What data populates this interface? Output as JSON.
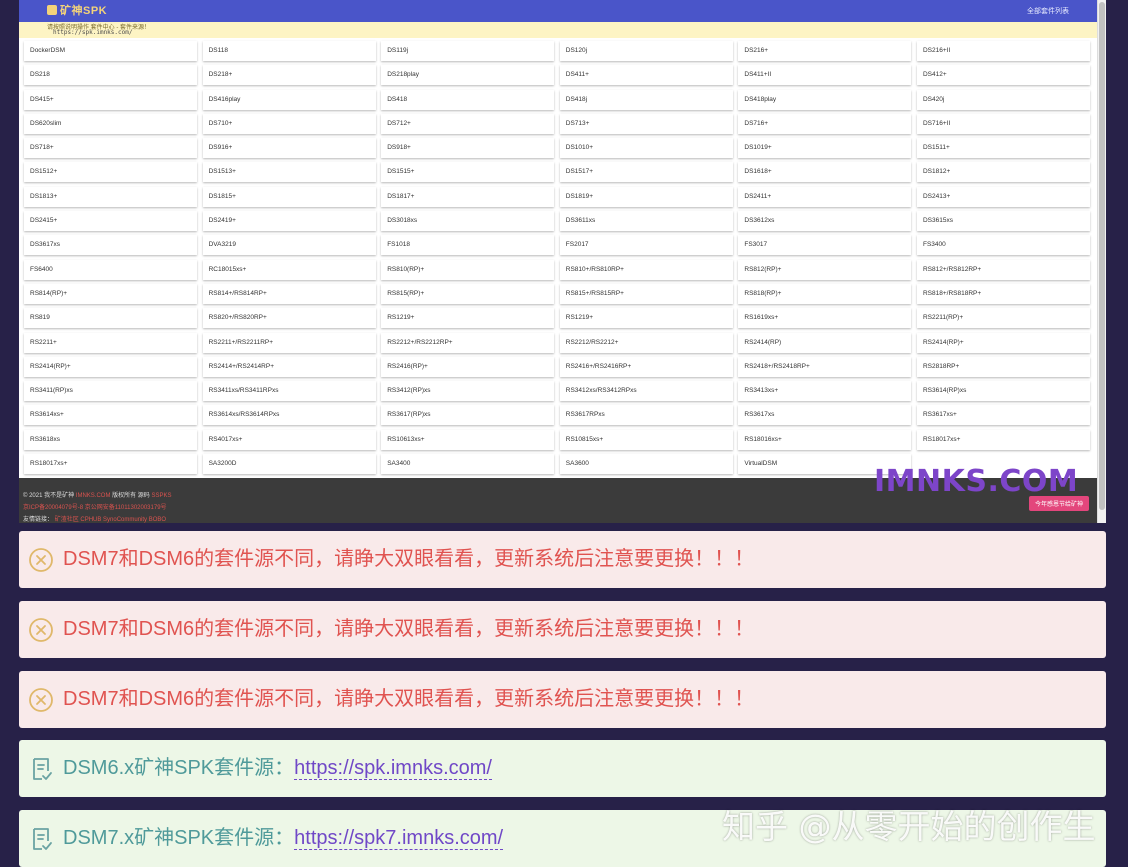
{
  "header": {
    "logo": "矿神SPK",
    "all_packages_link": "全部套件列表",
    "notice_line1": "请按照说明操作 套件中心 - 套件来源！",
    "notice_line2": "https://spk.imnks.com/"
  },
  "models": [
    "DockerDSM",
    "DS118",
    "DS119j",
    "DS120j",
    "DS216+",
    "DS216+II",
    "DS218",
    "DS218+",
    "DS218play",
    "DS411+",
    "DS411+II",
    "DS412+",
    "DS415+",
    "DS416play",
    "DS418",
    "DS418j",
    "DS418play",
    "DS420j",
    "DS620slim",
    "DS710+",
    "DS712+",
    "DS713+",
    "DS716+",
    "DS716+II",
    "DS718+",
    "DS916+",
    "DS918+",
    "DS1010+",
    "DS1019+",
    "DS1511+",
    "DS1512+",
    "DS1513+",
    "DS1515+",
    "DS1517+",
    "DS1618+",
    "DS1812+",
    "DS1813+",
    "DS1815+",
    "DS1817+",
    "DS1819+",
    "DS2411+",
    "DS2413+",
    "DS2415+",
    "DS2419+",
    "DS3018xs",
    "DS3611xs",
    "DS3612xs",
    "DS3615xs",
    "DS3617xs",
    "DVA3219",
    "FS1018",
    "FS2017",
    "FS3017",
    "FS3400",
    "FS6400",
    "RC18015xs+",
    "RS810(RP)+",
    "RS810+/RS810RP+",
    "RS812(RP)+",
    "RS812+/RS812RP+",
    "RS814(RP)+",
    "RS814+/RS814RP+",
    "RS815(RP)+",
    "RS815+/RS815RP+",
    "RS818(RP)+",
    "RS818+/RS818RP+",
    "RS819",
    "RS820+/RS820RP+",
    "RS1219+",
    "RS1219+",
    "RS1619xs+",
    "RS2211(RP)+",
    "RS2211+",
    "RS2211+/RS2211RP+",
    "RS2212+/RS2212RP+",
    "RS2212/RS2212+",
    "RS2414(RP)",
    "RS2414(RP)+",
    "RS2414(RP)+",
    "RS2414+/RS2414RP+",
    "RS2416(RP)+",
    "RS2416+/RS2416RP+",
    "RS2418+/RS2418RP+",
    "RS2818RP+",
    "RS3411(RP)xs",
    "RS3411xs/RS3411RPxs",
    "RS3412(RP)xs",
    "RS3412xs/RS3412RPxs",
    "RS3413xs+",
    "RS3614(RP)xs",
    "RS3614xs+",
    "RS3614xs/RS3614RPxs",
    "RS3617(RP)xs",
    "RS3617RPxs",
    "RS3617xs",
    "RS3617xs+",
    "RS3618xs",
    "RS4017xs+",
    "RS10613xs+",
    "RS10815xs+",
    "RS18016xs+",
    "RS18017xs+",
    "RS18017xs+",
    "SA3200D",
    "SA3400",
    "SA3600",
    "VirtualDSM"
  ],
  "footer": {
    "copyright_prefix": "© 2021 我不是矿神",
    "copyright_link": "IMNKS.COM",
    "copyright_mid": "版权所有 源码",
    "copyright_src": "SSPKS",
    "icp": "京ICP备20004079号-8 京公网安备11011302003179号",
    "friends_label": "友情链接：",
    "friends_links": "矿渣社区 CPHUB SynoCommunity BOBO",
    "brand": "IMNKS.COM",
    "cta": "今年感恩节给矿神"
  },
  "alerts": {
    "warning_text": "DSM7和DSM6的套件源不同，请睁大双眼看看，更新系统后注意要更换！！！",
    "dsm6_label": "DSM6.x矿神SPK套件源：",
    "dsm6_url": "https://spk.imnks.com/",
    "dsm7_label": "DSM7.x矿神SPK套件源：",
    "dsm7_url": "https://spk7.imnks.com/"
  },
  "watermark": "知乎 @从零开始的创作生",
  "colors": {
    "page_bg": "#272148",
    "topbar": "#4a55c9",
    "danger_bg": "#f9eaea",
    "danger_text": "#e05350",
    "success_bg": "#edf7e7",
    "success_text": "#4f9a9a",
    "link": "#7048c7",
    "brand": "#7d45c9"
  }
}
